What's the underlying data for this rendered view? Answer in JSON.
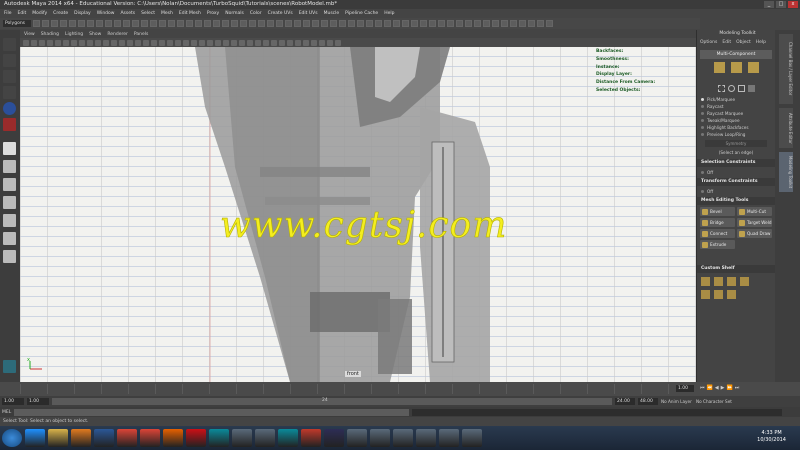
{
  "window": {
    "title": "Autodesk Maya 2014 x64 - Educational Version: C:\\Users\\Nolan\\Documents\\TurboSquid\\Tutorials\\scenes\\RobotModel.mb*",
    "controls": [
      "_",
      "□",
      "x"
    ]
  },
  "menubar": [
    "File",
    "Edit",
    "Modify",
    "Create",
    "Display",
    "Window",
    "Assets",
    "Select",
    "Mesh",
    "Edit Mesh",
    "Proxy",
    "Normals",
    "Color",
    "Create UVs",
    "Edit UVs",
    "Muscle",
    "Pipeline Cache",
    "Help"
  ],
  "status_line": {
    "mode": "Polygons"
  },
  "viewport": {
    "menu": [
      "View",
      "Shading",
      "Lighting",
      "Show",
      "Renderer",
      "Panels"
    ],
    "camera_label": "front",
    "hud": [
      "Backfaces:",
      "Smoothness:",
      "Instance:",
      "Display Layer:",
      "Distance From Camera:",
      "Selected Objects:"
    ],
    "watermark": "www.cgtsj.com",
    "axis_label": "x"
  },
  "modeling_toolkit": {
    "title": "Modeling Toolkit",
    "tabs": [
      "Options",
      "Edit",
      "Object",
      "Help"
    ],
    "multi_component": "Multi-Component",
    "select_options": [
      {
        "label": "Pick/Marquee",
        "on": true
      },
      {
        "label": "Raycast",
        "on": false
      },
      {
        "label": "Raycast Marquee",
        "on": false
      },
      {
        "label": "Tweak/Marquee",
        "on": false
      }
    ],
    "checks": [
      "Highlight Backfaces",
      "Preview Loop/Ring"
    ],
    "symmetry_label": "Symmetry",
    "hint": "(Select an edge)",
    "selection_constraints": {
      "title": "Selection Constraints",
      "value": "Off"
    },
    "transform_constraints": {
      "title": "Transform Constraints",
      "value": "Off"
    },
    "mesh_editing_tools": {
      "title": "Mesh Editing Tools",
      "buttons": [
        "Bevel",
        "Multi-Cut",
        "Bridge",
        "Target Weld",
        "Connect",
        "Quad Draw",
        "Extrude"
      ]
    },
    "custom_shelf": "Custom Shelf"
  },
  "right_tabs": [
    "Channel Box / Layer Editor",
    "Attribute Editor",
    "Modeling Toolkit"
  ],
  "time": {
    "current": "1.00",
    "range_start": "1.00",
    "range_start_2": "1.00",
    "range_mark": "24",
    "range_end": "24.00",
    "playback_end": "48.00",
    "anim_layer": "No Anim Layer",
    "char_set": "No Character Set"
  },
  "command_line": {
    "lang": "MEL"
  },
  "help_line": "Select Tool: Select an object to select.",
  "taskbar": {
    "apps": [
      "start",
      "ie",
      "explorer",
      "media",
      "word",
      "chrome",
      "chrome",
      "firefox",
      "opera",
      "maya",
      "app",
      "app",
      "maya",
      "record",
      "ae",
      "app",
      "app",
      "app",
      "app",
      "app",
      "app"
    ],
    "time": "4:33 PM",
    "date": "10/30/2014"
  }
}
